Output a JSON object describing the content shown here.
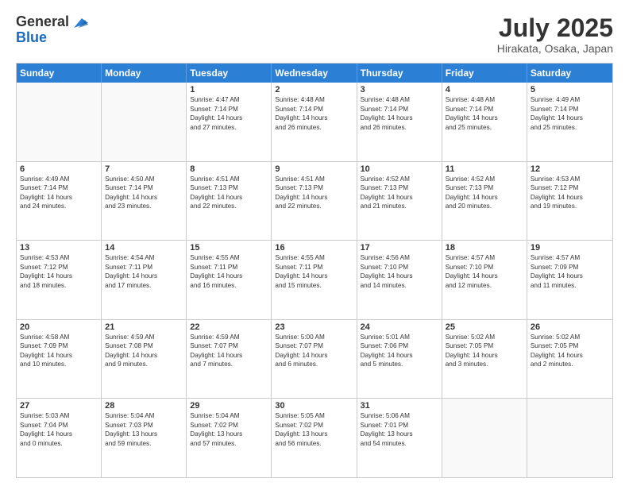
{
  "header": {
    "logo_line1": "General",
    "logo_line2": "Blue",
    "main_title": "July 2025",
    "subtitle": "Hirakata, Osaka, Japan"
  },
  "days_of_week": [
    "Sunday",
    "Monday",
    "Tuesday",
    "Wednesday",
    "Thursday",
    "Friday",
    "Saturday"
  ],
  "weeks": [
    [
      {
        "day": "",
        "sunrise": "",
        "sunset": "",
        "daylight": ""
      },
      {
        "day": "",
        "sunrise": "",
        "sunset": "",
        "daylight": ""
      },
      {
        "day": "1",
        "sunrise": "Sunrise: 4:47 AM",
        "sunset": "Sunset: 7:14 PM",
        "daylight": "Daylight: 14 hours and 27 minutes."
      },
      {
        "day": "2",
        "sunrise": "Sunrise: 4:48 AM",
        "sunset": "Sunset: 7:14 PM",
        "daylight": "Daylight: 14 hours and 26 minutes."
      },
      {
        "day": "3",
        "sunrise": "Sunrise: 4:48 AM",
        "sunset": "Sunset: 7:14 PM",
        "daylight": "Daylight: 14 hours and 26 minutes."
      },
      {
        "day": "4",
        "sunrise": "Sunrise: 4:48 AM",
        "sunset": "Sunset: 7:14 PM",
        "daylight": "Daylight: 14 hours and 25 minutes."
      },
      {
        "day": "5",
        "sunrise": "Sunrise: 4:49 AM",
        "sunset": "Sunset: 7:14 PM",
        "daylight": "Daylight: 14 hours and 25 minutes."
      }
    ],
    [
      {
        "day": "6",
        "sunrise": "Sunrise: 4:49 AM",
        "sunset": "Sunset: 7:14 PM",
        "daylight": "Daylight: 14 hours and 24 minutes."
      },
      {
        "day": "7",
        "sunrise": "Sunrise: 4:50 AM",
        "sunset": "Sunset: 7:14 PM",
        "daylight": "Daylight: 14 hours and 23 minutes."
      },
      {
        "day": "8",
        "sunrise": "Sunrise: 4:51 AM",
        "sunset": "Sunset: 7:13 PM",
        "daylight": "Daylight: 14 hours and 22 minutes."
      },
      {
        "day": "9",
        "sunrise": "Sunrise: 4:51 AM",
        "sunset": "Sunset: 7:13 PM",
        "daylight": "Daylight: 14 hours and 22 minutes."
      },
      {
        "day": "10",
        "sunrise": "Sunrise: 4:52 AM",
        "sunset": "Sunset: 7:13 PM",
        "daylight": "Daylight: 14 hours and 21 minutes."
      },
      {
        "day": "11",
        "sunrise": "Sunrise: 4:52 AM",
        "sunset": "Sunset: 7:13 PM",
        "daylight": "Daylight: 14 hours and 20 minutes."
      },
      {
        "day": "12",
        "sunrise": "Sunrise: 4:53 AM",
        "sunset": "Sunset: 7:12 PM",
        "daylight": "Daylight: 14 hours and 19 minutes."
      }
    ],
    [
      {
        "day": "13",
        "sunrise": "Sunrise: 4:53 AM",
        "sunset": "Sunset: 7:12 PM",
        "daylight": "Daylight: 14 hours and 18 minutes."
      },
      {
        "day": "14",
        "sunrise": "Sunrise: 4:54 AM",
        "sunset": "Sunset: 7:11 PM",
        "daylight": "Daylight: 14 hours and 17 minutes."
      },
      {
        "day": "15",
        "sunrise": "Sunrise: 4:55 AM",
        "sunset": "Sunset: 7:11 PM",
        "daylight": "Daylight: 14 hours and 16 minutes."
      },
      {
        "day": "16",
        "sunrise": "Sunrise: 4:55 AM",
        "sunset": "Sunset: 7:11 PM",
        "daylight": "Daylight: 14 hours and 15 minutes."
      },
      {
        "day": "17",
        "sunrise": "Sunrise: 4:56 AM",
        "sunset": "Sunset: 7:10 PM",
        "daylight": "Daylight: 14 hours and 14 minutes."
      },
      {
        "day": "18",
        "sunrise": "Sunrise: 4:57 AM",
        "sunset": "Sunset: 7:10 PM",
        "daylight": "Daylight: 14 hours and 12 minutes."
      },
      {
        "day": "19",
        "sunrise": "Sunrise: 4:57 AM",
        "sunset": "Sunset: 7:09 PM",
        "daylight": "Daylight: 14 hours and 11 minutes."
      }
    ],
    [
      {
        "day": "20",
        "sunrise": "Sunrise: 4:58 AM",
        "sunset": "Sunset: 7:09 PM",
        "daylight": "Daylight: 14 hours and 10 minutes."
      },
      {
        "day": "21",
        "sunrise": "Sunrise: 4:59 AM",
        "sunset": "Sunset: 7:08 PM",
        "daylight": "Daylight: 14 hours and 9 minutes."
      },
      {
        "day": "22",
        "sunrise": "Sunrise: 4:59 AM",
        "sunset": "Sunset: 7:07 PM",
        "daylight": "Daylight: 14 hours and 7 minutes."
      },
      {
        "day": "23",
        "sunrise": "Sunrise: 5:00 AM",
        "sunset": "Sunset: 7:07 PM",
        "daylight": "Daylight: 14 hours and 6 minutes."
      },
      {
        "day": "24",
        "sunrise": "Sunrise: 5:01 AM",
        "sunset": "Sunset: 7:06 PM",
        "daylight": "Daylight: 14 hours and 5 minutes."
      },
      {
        "day": "25",
        "sunrise": "Sunrise: 5:02 AM",
        "sunset": "Sunset: 7:05 PM",
        "daylight": "Daylight: 14 hours and 3 minutes."
      },
      {
        "day": "26",
        "sunrise": "Sunrise: 5:02 AM",
        "sunset": "Sunset: 7:05 PM",
        "daylight": "Daylight: 14 hours and 2 minutes."
      }
    ],
    [
      {
        "day": "27",
        "sunrise": "Sunrise: 5:03 AM",
        "sunset": "Sunset: 7:04 PM",
        "daylight": "Daylight: 14 hours and 0 minutes."
      },
      {
        "day": "28",
        "sunrise": "Sunrise: 5:04 AM",
        "sunset": "Sunset: 7:03 PM",
        "daylight": "Daylight: 13 hours and 59 minutes."
      },
      {
        "day": "29",
        "sunrise": "Sunrise: 5:04 AM",
        "sunset": "Sunset: 7:02 PM",
        "daylight": "Daylight: 13 hours and 57 minutes."
      },
      {
        "day": "30",
        "sunrise": "Sunrise: 5:05 AM",
        "sunset": "Sunset: 7:02 PM",
        "daylight": "Daylight: 13 hours and 56 minutes."
      },
      {
        "day": "31",
        "sunrise": "Sunrise: 5:06 AM",
        "sunset": "Sunset: 7:01 PM",
        "daylight": "Daylight: 13 hours and 54 minutes."
      },
      {
        "day": "",
        "sunrise": "",
        "sunset": "",
        "daylight": ""
      },
      {
        "day": "",
        "sunrise": "",
        "sunset": "",
        "daylight": ""
      }
    ]
  ]
}
